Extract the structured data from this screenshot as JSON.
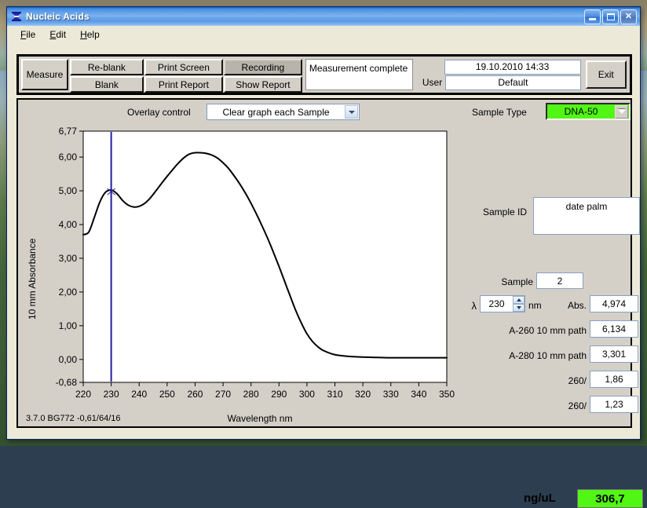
{
  "window": {
    "title": "Nucleic Acids",
    "icon": "spectrophotometer-icon",
    "minimize_label": "Minimize",
    "maximize_label": "Maximize",
    "close_label": "Close"
  },
  "menubar": {
    "items": [
      {
        "label": "File",
        "accel": "F"
      },
      {
        "label": "Edit",
        "accel": "E"
      },
      {
        "label": "Help",
        "accel": "H"
      }
    ]
  },
  "toolbar": {
    "measure_label": "Measure",
    "reblank_label": "Re-blank",
    "blank_label": "Blank",
    "print_screen_label": "Print Screen",
    "print_report_label": "Print Report",
    "recording_label": "Recording",
    "show_report_label": "Show Report",
    "status_text": "Measurement complete",
    "datetime": "19.10.2010  14:33",
    "user_label": "User",
    "user_value": "Default",
    "exit_label": "Exit"
  },
  "controls": {
    "overlay_label": "Overlay control",
    "overlay_value": "Clear graph each Sample",
    "sample_type_label": "Sample Type",
    "sample_type_value": "DNA-50",
    "sample_type_color": "#51f615"
  },
  "readouts": {
    "sample_id_label": "Sample ID",
    "sample_id_value": "date palm",
    "sample_label": "Sample",
    "sample_value": "2",
    "lambda_symbol": "λ",
    "lambda_value": "230",
    "nm_label": "nm",
    "abs_label": "Abs.",
    "abs_value": "4,974",
    "a260_label": "A-260 10 mm path",
    "a260_value": "6,134",
    "a280_label": "A-280 10 mm path",
    "a280_value": "3,301",
    "ratio1_label": "260/",
    "ratio1_value": "1,86",
    "ratio2_label": "260/",
    "ratio2_value": "1,23",
    "conc_units": "ng/uL",
    "conc_value": "306,7",
    "conc_color": "#51f615"
  },
  "footer": {
    "version": "3.7.0 BG772 -0,61/64/16"
  },
  "chart_data": {
    "type": "line",
    "title": "",
    "xlabel": "Wavelength nm",
    "ylabel": "10 mm Absorbance",
    "xlim": [
      220,
      350
    ],
    "ylim": [
      -0.68,
      6.77
    ],
    "xticks": [
      220,
      230,
      240,
      250,
      260,
      270,
      280,
      290,
      300,
      310,
      320,
      330,
      340,
      350
    ],
    "yticks": [
      -0.68,
      0.0,
      1.0,
      2.0,
      3.0,
      4.0,
      5.0,
      6.0,
      6.77
    ],
    "ytick_labels": [
      "-0,68",
      "0,00",
      "1,00",
      "2,00",
      "3,00",
      "4,00",
      "5,00",
      "6,00",
      "6,77"
    ],
    "grid": true,
    "grid_color": "#8a8a00",
    "line_color": "#000000",
    "cursor_line": {
      "x": 230,
      "color": "#2020a0",
      "marker_y": 4.974
    },
    "legend": null,
    "series": [
      {
        "name": "Absorbance",
        "x": [
          220,
          222,
          224,
          226,
          228,
          230,
          232,
          234,
          236,
          238,
          240,
          242,
          244,
          246,
          248,
          250,
          252,
          254,
          256,
          258,
          260,
          262,
          264,
          266,
          268,
          270,
          272,
          274,
          276,
          278,
          280,
          282,
          284,
          286,
          288,
          290,
          292,
          294,
          296,
          298,
          300,
          302,
          304,
          306,
          310,
          315,
          320,
          325,
          330,
          335,
          340,
          345,
          350
        ],
        "y": [
          3.7,
          3.78,
          4.22,
          4.68,
          4.96,
          5.02,
          4.92,
          4.72,
          4.58,
          4.52,
          4.54,
          4.63,
          4.79,
          5.0,
          5.22,
          5.43,
          5.63,
          5.82,
          5.98,
          6.09,
          6.13,
          6.13,
          6.11,
          6.06,
          5.97,
          5.83,
          5.66,
          5.44,
          5.2,
          4.93,
          4.63,
          4.3,
          3.95,
          3.58,
          3.18,
          2.76,
          2.32,
          1.88,
          1.45,
          1.08,
          0.76,
          0.53,
          0.37,
          0.26,
          0.14,
          0.09,
          0.07,
          0.06,
          0.05,
          0.05,
          0.05,
          0.05,
          0.05
        ]
      }
    ]
  }
}
